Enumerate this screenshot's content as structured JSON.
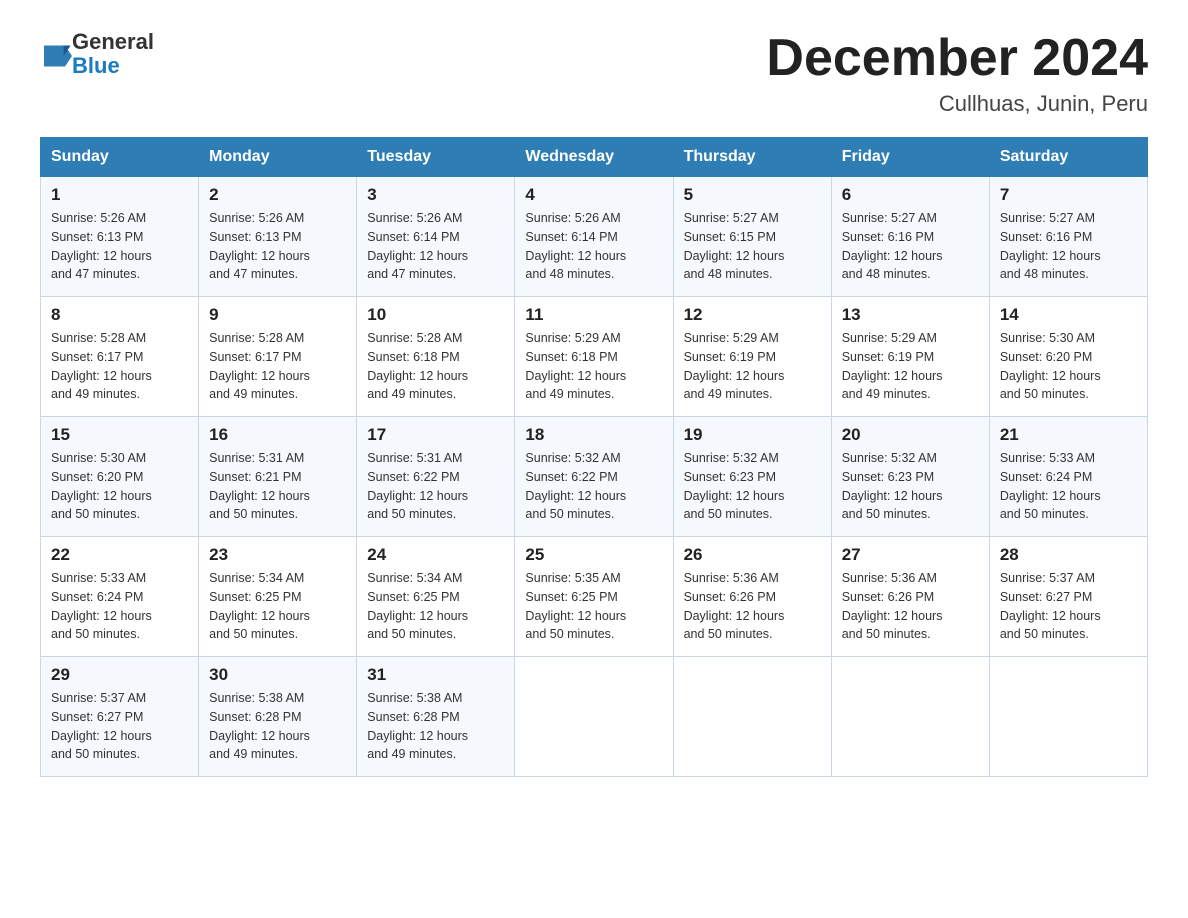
{
  "header": {
    "logo_general": "General",
    "logo_blue": "Blue",
    "month_title": "December 2024",
    "location": "Cullhuas, Junin, Peru"
  },
  "days_of_week": [
    "Sunday",
    "Monday",
    "Tuesday",
    "Wednesday",
    "Thursday",
    "Friday",
    "Saturday"
  ],
  "weeks": [
    [
      {
        "day": "1",
        "sunrise": "5:26 AM",
        "sunset": "6:13 PM",
        "daylight": "12 hours and 47 minutes."
      },
      {
        "day": "2",
        "sunrise": "5:26 AM",
        "sunset": "6:13 PM",
        "daylight": "12 hours and 47 minutes."
      },
      {
        "day": "3",
        "sunrise": "5:26 AM",
        "sunset": "6:14 PM",
        "daylight": "12 hours and 47 minutes."
      },
      {
        "day": "4",
        "sunrise": "5:26 AM",
        "sunset": "6:14 PM",
        "daylight": "12 hours and 48 minutes."
      },
      {
        "day": "5",
        "sunrise": "5:27 AM",
        "sunset": "6:15 PM",
        "daylight": "12 hours and 48 minutes."
      },
      {
        "day": "6",
        "sunrise": "5:27 AM",
        "sunset": "6:16 PM",
        "daylight": "12 hours and 48 minutes."
      },
      {
        "day": "7",
        "sunrise": "5:27 AM",
        "sunset": "6:16 PM",
        "daylight": "12 hours and 48 minutes."
      }
    ],
    [
      {
        "day": "8",
        "sunrise": "5:28 AM",
        "sunset": "6:17 PM",
        "daylight": "12 hours and 49 minutes."
      },
      {
        "day": "9",
        "sunrise": "5:28 AM",
        "sunset": "6:17 PM",
        "daylight": "12 hours and 49 minutes."
      },
      {
        "day": "10",
        "sunrise": "5:28 AM",
        "sunset": "6:18 PM",
        "daylight": "12 hours and 49 minutes."
      },
      {
        "day": "11",
        "sunrise": "5:29 AM",
        "sunset": "6:18 PM",
        "daylight": "12 hours and 49 minutes."
      },
      {
        "day": "12",
        "sunrise": "5:29 AM",
        "sunset": "6:19 PM",
        "daylight": "12 hours and 49 minutes."
      },
      {
        "day": "13",
        "sunrise": "5:29 AM",
        "sunset": "6:19 PM",
        "daylight": "12 hours and 49 minutes."
      },
      {
        "day": "14",
        "sunrise": "5:30 AM",
        "sunset": "6:20 PM",
        "daylight": "12 hours and 50 minutes."
      }
    ],
    [
      {
        "day": "15",
        "sunrise": "5:30 AM",
        "sunset": "6:20 PM",
        "daylight": "12 hours and 50 minutes."
      },
      {
        "day": "16",
        "sunrise": "5:31 AM",
        "sunset": "6:21 PM",
        "daylight": "12 hours and 50 minutes."
      },
      {
        "day": "17",
        "sunrise": "5:31 AM",
        "sunset": "6:22 PM",
        "daylight": "12 hours and 50 minutes."
      },
      {
        "day": "18",
        "sunrise": "5:32 AM",
        "sunset": "6:22 PM",
        "daylight": "12 hours and 50 minutes."
      },
      {
        "day": "19",
        "sunrise": "5:32 AM",
        "sunset": "6:23 PM",
        "daylight": "12 hours and 50 minutes."
      },
      {
        "day": "20",
        "sunrise": "5:32 AM",
        "sunset": "6:23 PM",
        "daylight": "12 hours and 50 minutes."
      },
      {
        "day": "21",
        "sunrise": "5:33 AM",
        "sunset": "6:24 PM",
        "daylight": "12 hours and 50 minutes."
      }
    ],
    [
      {
        "day": "22",
        "sunrise": "5:33 AM",
        "sunset": "6:24 PM",
        "daylight": "12 hours and 50 minutes."
      },
      {
        "day": "23",
        "sunrise": "5:34 AM",
        "sunset": "6:25 PM",
        "daylight": "12 hours and 50 minutes."
      },
      {
        "day": "24",
        "sunrise": "5:34 AM",
        "sunset": "6:25 PM",
        "daylight": "12 hours and 50 minutes."
      },
      {
        "day": "25",
        "sunrise": "5:35 AM",
        "sunset": "6:25 PM",
        "daylight": "12 hours and 50 minutes."
      },
      {
        "day": "26",
        "sunrise": "5:36 AM",
        "sunset": "6:26 PM",
        "daylight": "12 hours and 50 minutes."
      },
      {
        "day": "27",
        "sunrise": "5:36 AM",
        "sunset": "6:26 PM",
        "daylight": "12 hours and 50 minutes."
      },
      {
        "day": "28",
        "sunrise": "5:37 AM",
        "sunset": "6:27 PM",
        "daylight": "12 hours and 50 minutes."
      }
    ],
    [
      {
        "day": "29",
        "sunrise": "5:37 AM",
        "sunset": "6:27 PM",
        "daylight": "12 hours and 50 minutes."
      },
      {
        "day": "30",
        "sunrise": "5:38 AM",
        "sunset": "6:28 PM",
        "daylight": "12 hours and 49 minutes."
      },
      {
        "day": "31",
        "sunrise": "5:38 AM",
        "sunset": "6:28 PM",
        "daylight": "12 hours and 49 minutes."
      },
      null,
      null,
      null,
      null
    ]
  ],
  "sunrise_label": "Sunrise:",
  "sunset_label": "Sunset:",
  "daylight_label": "Daylight:"
}
